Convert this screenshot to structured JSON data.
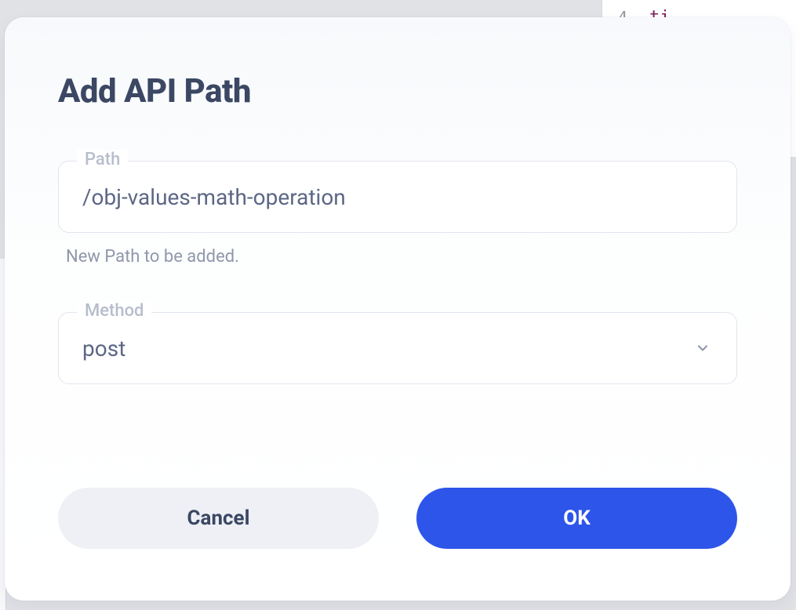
{
  "dialog": {
    "title": "Add API Path",
    "path_label": "Path",
    "path_value": "/obj-values-math-operation",
    "path_helper": "New Path to be added.",
    "method_label": "Method",
    "method_value": "post",
    "cancel_label": "Cancel",
    "ok_label": "OK"
  },
  "background": {
    "line_number": "4",
    "code_fragment": "ti"
  }
}
